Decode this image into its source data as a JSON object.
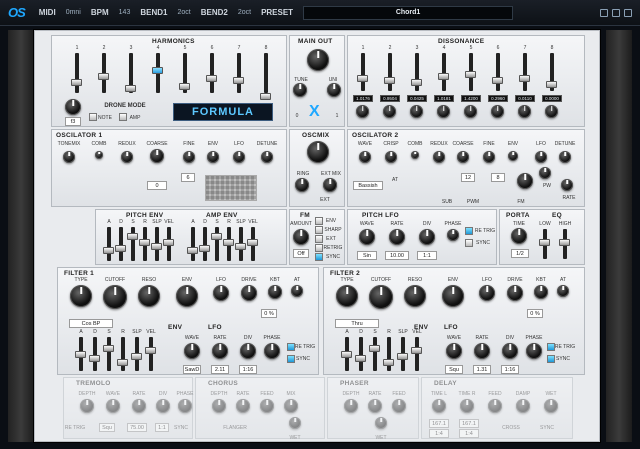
{
  "topbar": {
    "logo": "OS",
    "midi_label": "MIDI",
    "midi_value": "0mni",
    "bpm_label": "BPM",
    "bpm_value": "143",
    "bend1_label": "BEND1",
    "bend1_value": "2oct",
    "bend2_label": "BEND2",
    "bend2_value": "2oct",
    "preset_label": "PRESET",
    "preset_name": "Chord1"
  },
  "harmonics": {
    "title": "HARMONICS",
    "numbers": [
      "1",
      "2",
      "3",
      "4",
      "5",
      "6",
      "7",
      "8"
    ],
    "drone_value": "f3",
    "drone_mode": "DRONE MODE",
    "note": "NOTE",
    "amp": "AMP"
  },
  "formula": "FORMULA",
  "mainout": {
    "title": "MAIN OUT",
    "tune": "TUNE",
    "uni": "UNI",
    "left": "0",
    "right": "1"
  },
  "dissonance": {
    "title": "DISSONANCE",
    "numbers": [
      "1",
      "2",
      "3",
      "4",
      "5",
      "6",
      "7",
      "8"
    ],
    "values": [
      "1.0176",
      "0.9504",
      "0.0425",
      "1.0181",
      "1.4200",
      "0.2960",
      "0.0110",
      "0.0000"
    ]
  },
  "osc1": {
    "title": "OSCILATOR 1",
    "labels": [
      "TONEMIX",
      "COMB",
      "REDUX",
      "COARSE",
      "FINE",
      "ENV",
      "LFO",
      "DETUNE"
    ],
    "coarse_val": "0",
    "fine_val": "6"
  },
  "oscmix": {
    "title": "OSCMIX",
    "ring": "RING",
    "extmix": "EXT MIX",
    "ext": "EXT"
  },
  "osc2": {
    "title": "OSCILATOR 2",
    "labels": [
      "WAVE",
      "CRISP",
      "COMB",
      "REDUX",
      "COARSE",
      "FINE",
      "ENV",
      "LFO",
      "DETUNE"
    ],
    "wave_val": "Bassish",
    "at": "AT",
    "coarse_val": "12",
    "fine_val": "8",
    "sub": "SUB",
    "pwm": "PWM",
    "fm": "FM",
    "pw": "PW",
    "rate": "RATE"
  },
  "pitchenv": {
    "title": "PITCH ENV",
    "labels": [
      "A",
      "D",
      "S",
      "R",
      "SLP",
      "VEL"
    ]
  },
  "ampenv": {
    "title": "AMP ENV",
    "labels": [
      "A",
      "D",
      "S",
      "R",
      "SLP",
      "VEL"
    ]
  },
  "fm": {
    "title": "FM",
    "amount": "AMOUNT",
    "value": "Off",
    "env": "ENV",
    "sharp": "SHARP",
    "ext": "EXT",
    "retrig": "RETRIG",
    "sync": "SYNC"
  },
  "pitchlfo": {
    "title": "PITCH LFO",
    "labels": [
      "WAVE",
      "RATE",
      "DIV",
      "PHASE"
    ],
    "wave_val": "Sin",
    "rate_val": "10.00",
    "div_val": "1:1",
    "retrig": "RE TRIG",
    "sync": "SYNC"
  },
  "porta": {
    "title": "PORTA",
    "time": "TIME",
    "value": "1/2"
  },
  "eq": {
    "title": "EQ",
    "low": "LOW",
    "high": "HIGH"
  },
  "filter1": {
    "title": "FILTER 1",
    "labels": [
      "TYPE",
      "CUTOFF",
      "RESO",
      "ENV",
      "LFO",
      "DRIVE",
      "KBT",
      "AT"
    ],
    "type_val": "Cos BP",
    "kbt_val": "0 %",
    "env_title": "ENV",
    "env_labels": [
      "A",
      "D",
      "S",
      "R",
      "SLP",
      "VEL"
    ],
    "lfo_title": "LFO",
    "lfo_labels": [
      "WAVE",
      "RATE",
      "DIV",
      "PHASE"
    ],
    "wave_val": "SawD",
    "rate_val": "2.11",
    "div_val": "1:16",
    "retrig": "RE TRIG",
    "sync": "SYNC"
  },
  "filter2": {
    "title": "FILTER 2",
    "labels": [
      "TYPE",
      "CUTOFF",
      "RESO",
      "ENV",
      "LFO",
      "DRIVE",
      "KBT",
      "AT"
    ],
    "type_val": "Thru",
    "kbt_val": "0 %",
    "env_title": "ENV",
    "env_labels": [
      "A",
      "D",
      "S",
      "R",
      "SLP",
      "VEL"
    ],
    "lfo_title": "LFO",
    "lfo_labels": [
      "WAVE",
      "RATE",
      "DIV",
      "PHASE"
    ],
    "wave_val": "Squ",
    "rate_val": "1.31",
    "div_val": "1:16",
    "retrig": "RE TRIG",
    "sync": "SYNC"
  },
  "tremolo": {
    "title": "TREMOLO",
    "labels": [
      "DEPTH",
      "WAVE",
      "RATE",
      "DIV",
      "PHASE"
    ],
    "wave_val": "Squ",
    "rate_val": "75.00",
    "div_val": "1:1",
    "retrig": "RE TRIG",
    "sync": "SYNC"
  },
  "chorus": {
    "title": "CHORUS",
    "labels": [
      "DEPTH",
      "RATE",
      "FEED",
      "MIX"
    ],
    "wet": "WET",
    "flanger": "FLANGER"
  },
  "phaser": {
    "title": "PHASER",
    "labels": [
      "DEPTH",
      "RATE",
      "FEED"
    ],
    "wet": "WET"
  },
  "delay": {
    "title": "DELAY",
    "labels": [
      "TIME L",
      "TIME R",
      "FEED",
      "DAMP",
      "WET"
    ],
    "time_l": "167.1",
    "time_r": "167.1",
    "div_l": "1:4",
    "div_r": "1:4",
    "cross": "CROSS",
    "sync": "SYNC"
  },
  "colors": {
    "accent": "#2a9ee0",
    "background": "#0a0e14"
  }
}
